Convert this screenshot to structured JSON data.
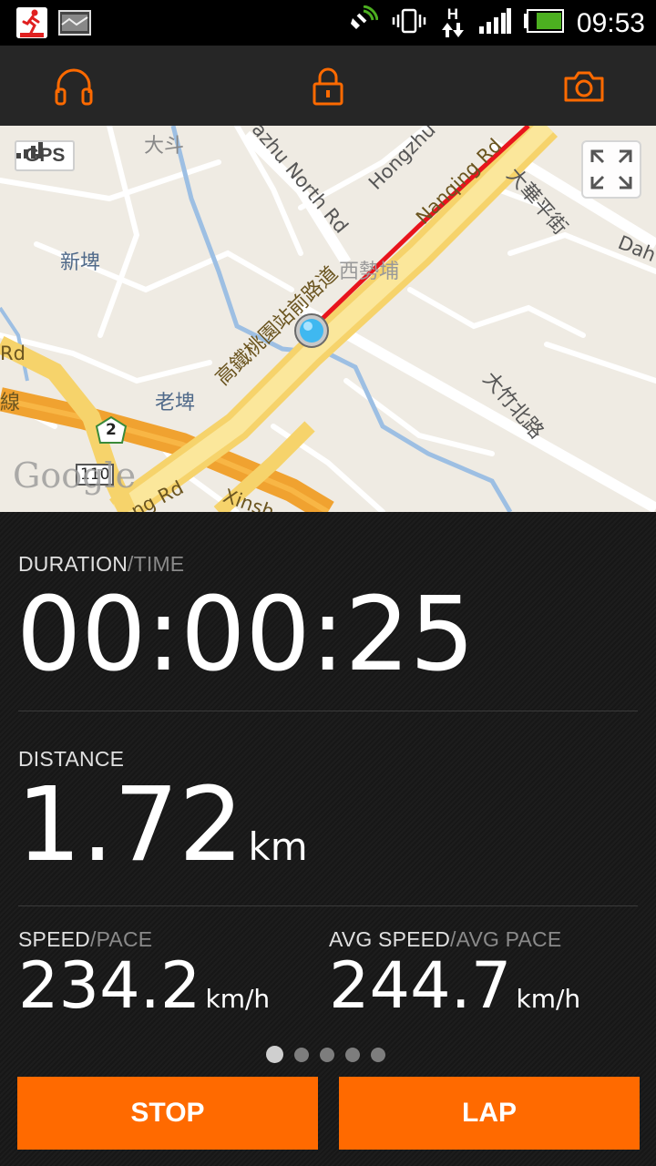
{
  "status_bar": {
    "time": "09:53",
    "network_type": "H",
    "battery_color": "#4caf20"
  },
  "toolbar": {
    "icons": [
      "headphones-icon",
      "lock-icon",
      "camera-icon"
    ],
    "accent": "#ff6a00"
  },
  "map": {
    "gps_label": "GPS",
    "labels": {
      "dadou": "大斗",
      "xinpi": "新埤",
      "laopi": "老埤",
      "xizhoupu": "西勢埔",
      "hsr_road": "高鐵桃園站前路道",
      "dazhu_north": "大竹北路",
      "daxing": "大華平街",
      "dazhu_north_rd": "azhu North Rd",
      "hongzhu": "Hongzhu",
      "nanqing": "Nanqing Rd",
      "dah": "Dah",
      "xinsh": "Xinsh",
      "ng_rd": "ng Rd",
      "rd": "Rd",
      "xian": "線",
      "shield2": "2",
      "shield110": "110",
      "google": "Google"
    },
    "route_color": "#e8141c"
  },
  "duration": {
    "label": "DURATION",
    "sub_label": "/TIME",
    "value": "00:00:25"
  },
  "distance": {
    "label": "DISTANCE",
    "value": "1.72",
    "unit": "km"
  },
  "speed": {
    "label": "SPEED",
    "sub_label": "/PACE",
    "value": "234.2",
    "unit": "km/h"
  },
  "avg_speed": {
    "label": "AVG SPEED",
    "sub_label": "/AVG PACE",
    "value": "244.7",
    "unit": "km/h"
  },
  "pager": {
    "count": 5,
    "active_index": 0
  },
  "buttons": {
    "stop": "STOP",
    "lap": "LAP"
  }
}
